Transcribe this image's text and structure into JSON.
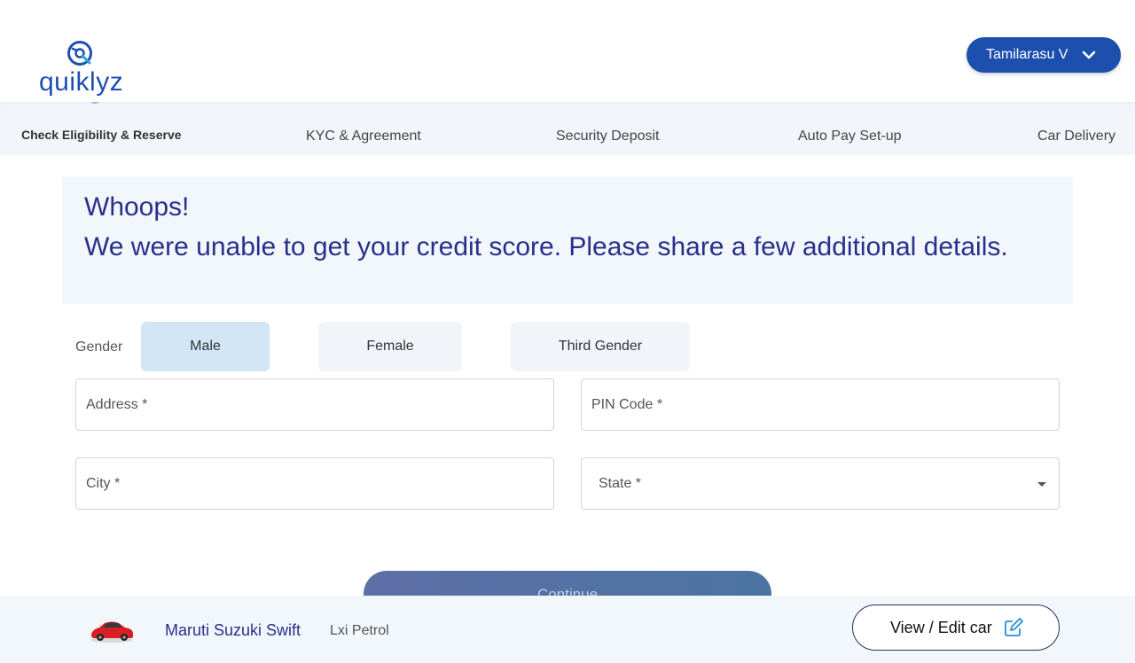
{
  "header": {
    "logo_text": "quiklyz",
    "user_name": "Tamilarasu V",
    "user_menu_icon": "chevron-down-icon"
  },
  "stepper": {
    "steps": [
      {
        "label": "Check Eligibility & Reserve",
        "active": true
      },
      {
        "label": "KYC & Agreement",
        "active": false
      },
      {
        "label": "Security Deposit",
        "active": false
      },
      {
        "label": "Auto Pay Set-up",
        "active": false
      },
      {
        "label": "Car Delivery",
        "active": false
      }
    ]
  },
  "banner": {
    "title": "Whoops!",
    "message": "We were unable to get your credit score. Please share a few additional details."
  },
  "form": {
    "gender_label": "Gender",
    "gender_options": [
      "Male",
      "Female",
      "Third Gender"
    ],
    "gender_selected": "Male",
    "address_placeholder": "Address *",
    "pin_placeholder": "PIN Code *",
    "city_placeholder": "City *",
    "state_placeholder": "State *",
    "continue_label": "Continue"
  },
  "bottom_bar": {
    "car_name": "Maruti Suzuki Swift",
    "car_variant": "Lxi Petrol",
    "edit_label": "View / Edit car",
    "edit_icon": "edit-icon"
  },
  "colors": {
    "primary": "#1d4fae",
    "heading": "#2a2f8c",
    "selected_option": "#d2e6f5",
    "panel_bg": "#f2f7fc"
  }
}
